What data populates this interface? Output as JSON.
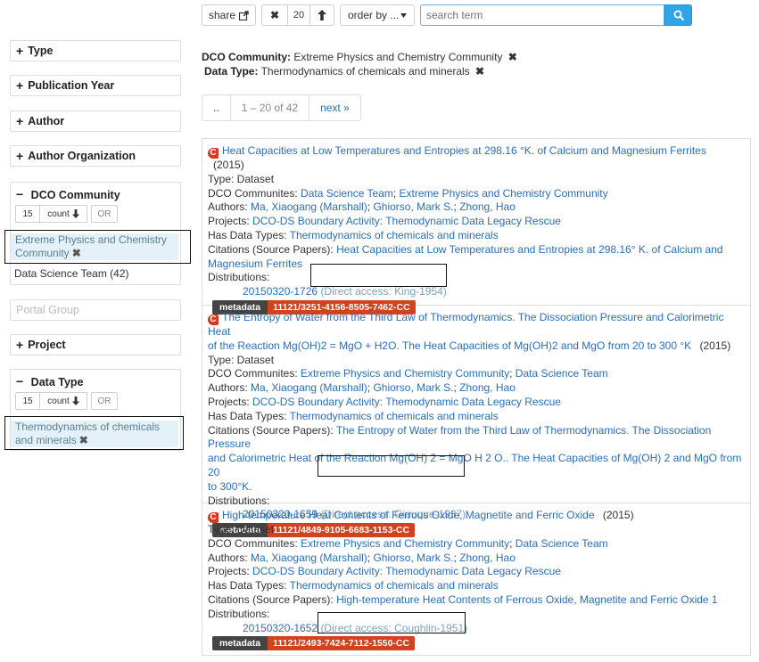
{
  "toolbar": {
    "share_label": "share",
    "share_icon": "share-icon",
    "clear_label": "✖",
    "page_size": "20",
    "sort_up": "🡑",
    "order_label": "order by ...",
    "search_placeholder": "search term",
    "search_icon": "search-icon"
  },
  "active_filters": [
    {
      "label": "DCO Community:",
      "value": "Extreme Physics and Chemistry Community",
      "remove": "✖"
    },
    {
      "label": "Data Type:",
      "value": "Thermodynamics of chemicals and minerals",
      "remove": "✖"
    }
  ],
  "pager": {
    "prev": "..",
    "range": "1 – 20 of 42",
    "next": "next »"
  },
  "sidebar": {
    "collapsed_sign": "+",
    "expanded_sign": "−",
    "facets": [
      "Type",
      "Publication Year",
      "Author",
      "Author Organization"
    ],
    "dco": {
      "title": "DCO Community",
      "count": "15",
      "count_label": "count",
      "or_label": "OR",
      "selected_line1": "Extreme Physics and Chemistry",
      "selected_line2": "Community",
      "remove": "✖",
      "option": "Data Science Team (42)"
    },
    "portal_group": "Portal Group",
    "project": "Project",
    "datatype": {
      "title": "Data Type",
      "count": "15",
      "count_label": "count",
      "or_label": "OR",
      "selected_line1": "Thermodynamics of chemicals",
      "selected_line2": "and minerals",
      "remove": "✖"
    }
  },
  "results": [
    {
      "title": "Heat Capacities at Low Temperatures and Entropies at 298.16 °K. of Calcium and Magnesium Ferrites",
      "year": "(2015)",
      "type": "Type: Dataset",
      "communities_label": "DCO Communites:",
      "communities": [
        "Data Science Team",
        "Extreme Physics and Chemistry Community"
      ],
      "authors_label": "Authors:",
      "authors": [
        "Ma, Xiaogang (Marshall)",
        "Ghiorso, Mark S.",
        "Zhong, Hao"
      ],
      "projects_label": "Projects:",
      "project": "DCO-DS Boundary Activity: Themodynamic Data Legacy Rescue",
      "datatypes_label": "Has Data Types:",
      "datatype": "Thermodynamics of chemicals and minerals",
      "citations_label": "Citations (Source Papers):",
      "citation_line1": "Heat Capacities at Low Temperatures and Entropies at 298.16° K. of Calcium and",
      "citation_line2": "Magnesium Ferrites",
      "distributions_label": "Distributions:",
      "dist_id": "20150320-1726",
      "direct_access": "(Direct access: King-1954)",
      "metadata_label": "metadata",
      "doi": "11121/3251-4156-8505-7462-CC"
    },
    {
      "title_line1": "The Entropy of Water from the Third Law of Thermodynamics. The Dissociation Pressure and Calorimetric Heat",
      "title_line2": "of the Reaction Mg(OH)2 = MgO + H2O. The Heat Capacities of Mg(OH)2 and MgO from 20 to 300 °K",
      "year": "(2015)",
      "type": "Type: Dataset",
      "communities_label": "DCO Communites:",
      "communities": [
        "Extreme Physics and Chemistry Community",
        "Data Science Team"
      ],
      "authors_label": "Authors:",
      "authors": [
        "Ma, Xiaogang (Marshall)",
        "Ghiorso, Mark S.",
        "Zhong, Hao"
      ],
      "projects_label": "Projects:",
      "project": "DCO-DS Boundary Activity: Themodynamic Data Legacy Rescue",
      "datatypes_label": "Has Data Types:",
      "datatype": "Thermodynamics of chemicals and minerals",
      "citations_label": "Citations (Source Papers):",
      "citation_line1": "The Entropy of Water from the Third Law of Thermodynamics. The Dissociation Pressure",
      "citation_line2": "and Calorimetric Heat of the Reaction Mg(OH) 2 = MgO H 2 O.. The Heat Capacities of Mg(OH) 2 and MgO from 20",
      "citation_line3": "to 300°K.",
      "distributions_label": "Distributions:",
      "dist_id": "20150320-1659",
      "direct_access": "(Direct access: Giauque-1937)",
      "metadata_label": "metadata",
      "doi": "11121/4849-9105-6683-1153-CC"
    },
    {
      "title": "High-temperature Heat Contents of Ferrous Oxide, Magnetite and Ferric Oxide",
      "year": "(2015)",
      "type": "Type: Dataset",
      "communities_label": "DCO Communites:",
      "communities": [
        "Extreme Physics and Chemistry Community",
        "Data Science Team"
      ],
      "authors_label": "Authors:",
      "authors": [
        "Ma, Xiaogang (Marshall)",
        "Ghiorso, Mark S.",
        "Zhong, Hao"
      ],
      "projects_label": "Projects:",
      "project": "DCO-DS Boundary Activity: Themodynamic Data Legacy Rescue",
      "datatypes_label": "Has Data Types:",
      "datatype": "Thermodynamics of chemicals and minerals",
      "citations_label": "Citations (Source Papers):",
      "citation_line1": "High-temperature Heat Contents of Ferrous Oxide, Magnetite and Ferric Oxide 1",
      "distributions_label": "Distributions:",
      "dist_id": "20150320-1652",
      "direct_access": "(Direct access: Coughlin-1951)",
      "metadata_label": "metadata",
      "doi": "11121/2493-7424-7112-1550-CC"
    }
  ],
  "sep": "; ",
  "colors": {
    "link": "#2a6ebb",
    "accent": "#2fa4e7",
    "doi_badge": "#d1421f",
    "meta_badge": "#444444",
    "selected_bg": "#e4f1f8"
  }
}
